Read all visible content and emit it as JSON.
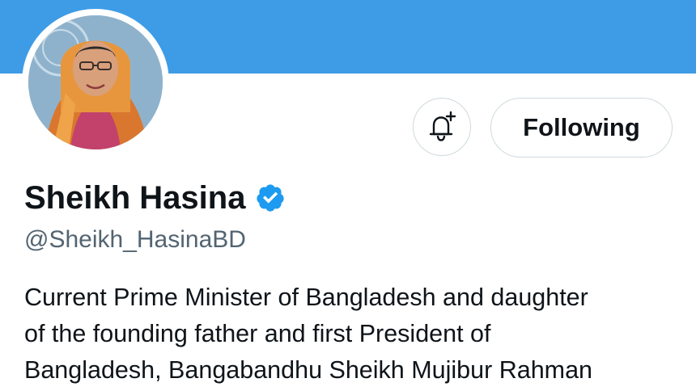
{
  "profile": {
    "display_name": "Sheikh Hasina",
    "handle": "@Sheikh_HasinaBD",
    "verified": true,
    "bio_lines": [
      "Current Prime Minister of Bangladesh and daughter",
      "of the founding father and first President of",
      "Bangladesh, Bangabandhu Sheikh Mujibur Rahman"
    ]
  },
  "actions": {
    "following_label": "Following",
    "notification_icon": "bell-plus-icon"
  },
  "colors": {
    "banner": "#3e9ce6",
    "verified_badge": "#1d9bf0",
    "text_primary": "#0f1419",
    "text_secondary": "#536471",
    "button_border": "#cfd9de"
  }
}
